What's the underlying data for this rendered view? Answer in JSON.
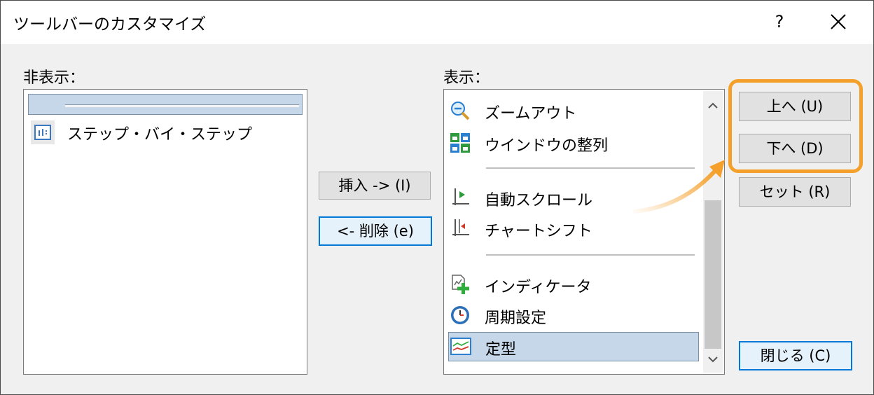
{
  "window": {
    "title": "ツールバーのカスタマイズ",
    "help_label": "?"
  },
  "hidden_panel": {
    "label": "非表示：",
    "items": [
      {
        "label": "",
        "icon": "separator-icon"
      },
      {
        "label": "ステップ・バイ・ステップ",
        "icon": "step-icon"
      }
    ]
  },
  "middle_buttons": {
    "insert_label": "挿入 -> (I)",
    "remove_label": "<- 削除 (e)"
  },
  "shown_panel": {
    "label": "表示：",
    "items": [
      {
        "label": "ズームアウト",
        "icon": "zoom-out-icon"
      },
      {
        "label": "ウインドウの整列",
        "icon": "tile-windows-icon"
      },
      {
        "label": "",
        "icon": "separator"
      },
      {
        "label": "自動スクロール",
        "icon": "auto-scroll-icon"
      },
      {
        "label": "チャートシフト",
        "icon": "chart-shift-icon"
      },
      {
        "label": "",
        "icon": "separator"
      },
      {
        "label": "インディケータ",
        "icon": "indicator-add-icon"
      },
      {
        "label": "周期設定",
        "icon": "clock-icon"
      },
      {
        "label": "定型",
        "icon": "template-icon"
      }
    ],
    "selected": "定型"
  },
  "right_buttons": {
    "up_label": "上へ (U)",
    "down_label": "下へ (D)",
    "reset_label": "セット (R)",
    "close_label": "閉じる (C)"
  },
  "colors": {
    "highlight_orange": "#f4a02a",
    "selection": "#c5d7e8",
    "focus_border": "#0078d7"
  }
}
